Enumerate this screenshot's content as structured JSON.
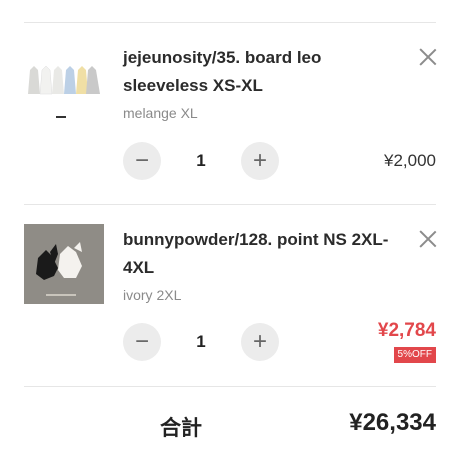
{
  "cart": {
    "items": [
      {
        "title": "jejeunosity/35. board leo sleeveless XS-XL",
        "variant": "melange XL",
        "quantity": "1",
        "price": "¥2,000",
        "decrease_icon": "minus-icon",
        "increase_icon": "plus-icon",
        "remove_icon": "close-icon",
        "image_desc_colors": [
          "#d9d9d6",
          "#f2f2f0",
          "#bcd0e6",
          "#f0dfa5",
          "#c9c9c9"
        ]
      },
      {
        "title": "bunnypowder/128. point NS 2XL-4XL",
        "variant": "ivory 2XL",
        "quantity": "1",
        "price": "¥2,784",
        "discount_badge": "5%OFF",
        "decrease_icon": "minus-icon",
        "increase_icon": "plus-icon",
        "remove_icon": "close-icon",
        "image_caption": "Bunny + Powder"
      }
    ],
    "total_label": "合計",
    "total_value": "¥26,334"
  },
  "colors": {
    "sale": "#e2474b",
    "button_bg": "#ececec",
    "divider": "#e6e6e6"
  }
}
